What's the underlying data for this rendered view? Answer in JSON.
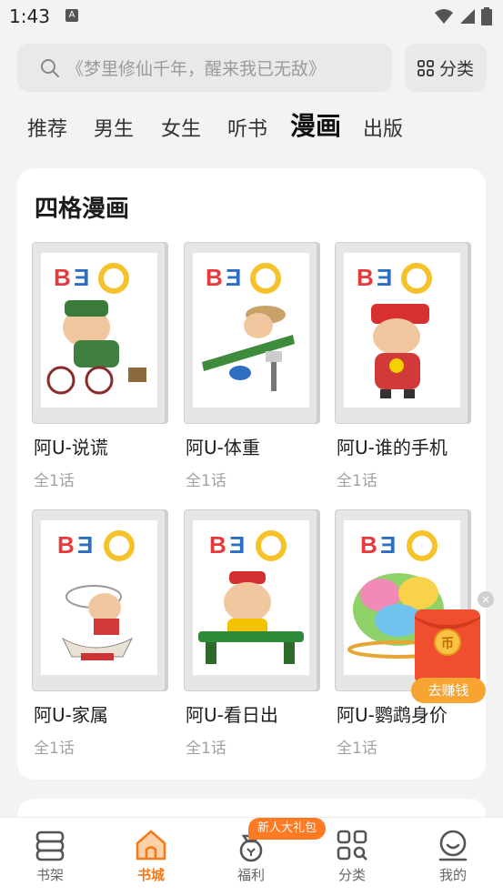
{
  "status": {
    "time": "1:43",
    "app_badge": "A"
  },
  "search": {
    "placeholder": "《梦里修仙千年，醒来我已无敌》",
    "search_icon": "search-icon"
  },
  "category_button": {
    "label": "分类",
    "icon": "grid-icon"
  },
  "tabs": [
    {
      "label": "推荐"
    },
    {
      "label": "男生"
    },
    {
      "label": "女生"
    },
    {
      "label": "听书"
    },
    {
      "label": "漫画"
    },
    {
      "label": "出版"
    }
  ],
  "active_tab": "漫画",
  "section": {
    "title": "四格漫画",
    "items": [
      {
        "title": "阿U-说谎",
        "sub": "全1话"
      },
      {
        "title": "阿U-体重",
        "sub": "全1话"
      },
      {
        "title": "阿U-谁的手机",
        "sub": "全1话"
      },
      {
        "title": "阿U-家属",
        "sub": "全1话"
      },
      {
        "title": "阿U-看日出",
        "sub": "全1话"
      },
      {
        "title": "阿U-鹦鹉身价",
        "sub": "全1话"
      }
    ]
  },
  "float_ad": {
    "label": "去赚钱",
    "close": "×",
    "coin": "币"
  },
  "bottom_nav": {
    "items": [
      {
        "label": "书架",
        "icon": "bookshelf-icon"
      },
      {
        "label": "书城",
        "icon": "store-home-icon"
      },
      {
        "label": "福利",
        "icon": "welfare-bag-icon"
      },
      {
        "label": "分类",
        "icon": "category-grid-icon"
      },
      {
        "label": "我的",
        "icon": "profile-icon"
      }
    ],
    "badge": "新人大礼包"
  },
  "colors": {
    "accent": "#f07a1c",
    "badge": "#ff7a24",
    "background": "#f3f3f3"
  }
}
